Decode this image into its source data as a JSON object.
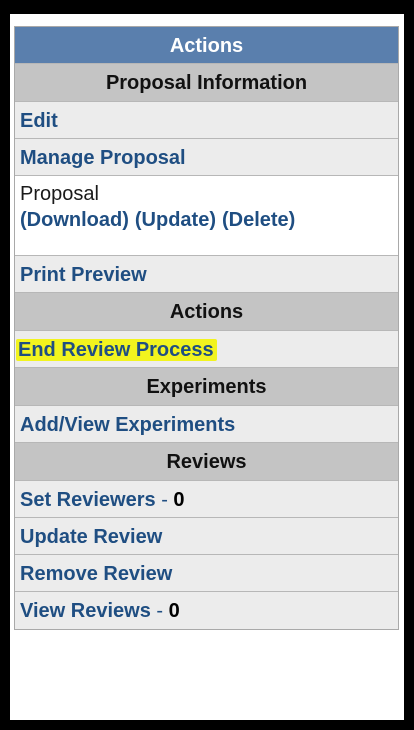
{
  "panel": {
    "title": "Actions",
    "sections": {
      "proposal_information": "Proposal Information",
      "actions": "Actions",
      "experiments": "Experiments",
      "reviews": "Reviews"
    },
    "proposal_info_items": {
      "edit": "Edit",
      "manage_proposal": "Manage Proposal",
      "proposal_label": "Proposal",
      "download": "(Download)",
      "update": "(Update)",
      "delete": "(Delete)",
      "print_preview": "Print Preview"
    },
    "action_items": {
      "end_review_process": "End Review Process"
    },
    "experiment_items": {
      "add_view_experiments": "Add/View Experiments"
    },
    "review_items": {
      "set_reviewers": "Set Reviewers",
      "set_reviewers_count": "0",
      "update_review": "Update Review",
      "remove_review": "Remove Review",
      "view_reviews": "View Reviews",
      "view_reviews_count": "0",
      "separator": " - "
    }
  },
  "colors": {
    "header_bg": "#5a7fad",
    "section_bg": "#c4c4c4",
    "alt_row_bg": "#ececec",
    "link": "#1f4e82",
    "highlight": "#f2f41e"
  }
}
